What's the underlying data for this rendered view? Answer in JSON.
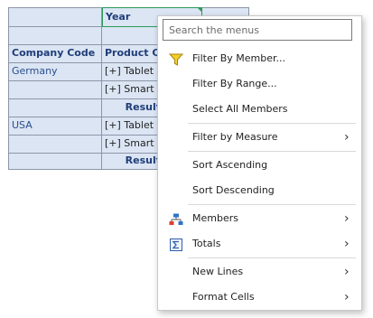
{
  "grid": {
    "year_header": "Year",
    "company_code_header": "Company Code",
    "product_header": "Product C",
    "rows": [
      {
        "company": "Germany",
        "product": "[+] Tablet"
      },
      {
        "company": "",
        "product": "[+] Smart"
      },
      {
        "result": "Result"
      },
      {
        "company": "USA",
        "product": "[+] Tablet"
      },
      {
        "company": "",
        "product": "[+] Smart"
      },
      {
        "result": "Result"
      }
    ]
  },
  "menu": {
    "search_placeholder": "Search the menus",
    "items": [
      {
        "label": "Filter By Member...",
        "icon": "filter-funnel-icon"
      },
      {
        "label": "Filter By Range..."
      },
      {
        "label": "Select All Members"
      },
      {
        "label": "Filter by Measure",
        "submenu": true
      },
      {
        "label": "Sort Ascending"
      },
      {
        "label": "Sort Descending"
      },
      {
        "label": "Members",
        "icon": "hierarchy-icon",
        "submenu": true
      },
      {
        "label": "Totals",
        "icon": "sigma-icon",
        "submenu": true
      },
      {
        "label": "New Lines",
        "submenu": true
      },
      {
        "label": "Format Cells",
        "submenu": true
      }
    ]
  },
  "colors": {
    "grid_header_bg": "#dbe5f3",
    "grid_text": "#1f3d79",
    "selection": "#2c9a5a",
    "funnel": "#e0b400"
  }
}
